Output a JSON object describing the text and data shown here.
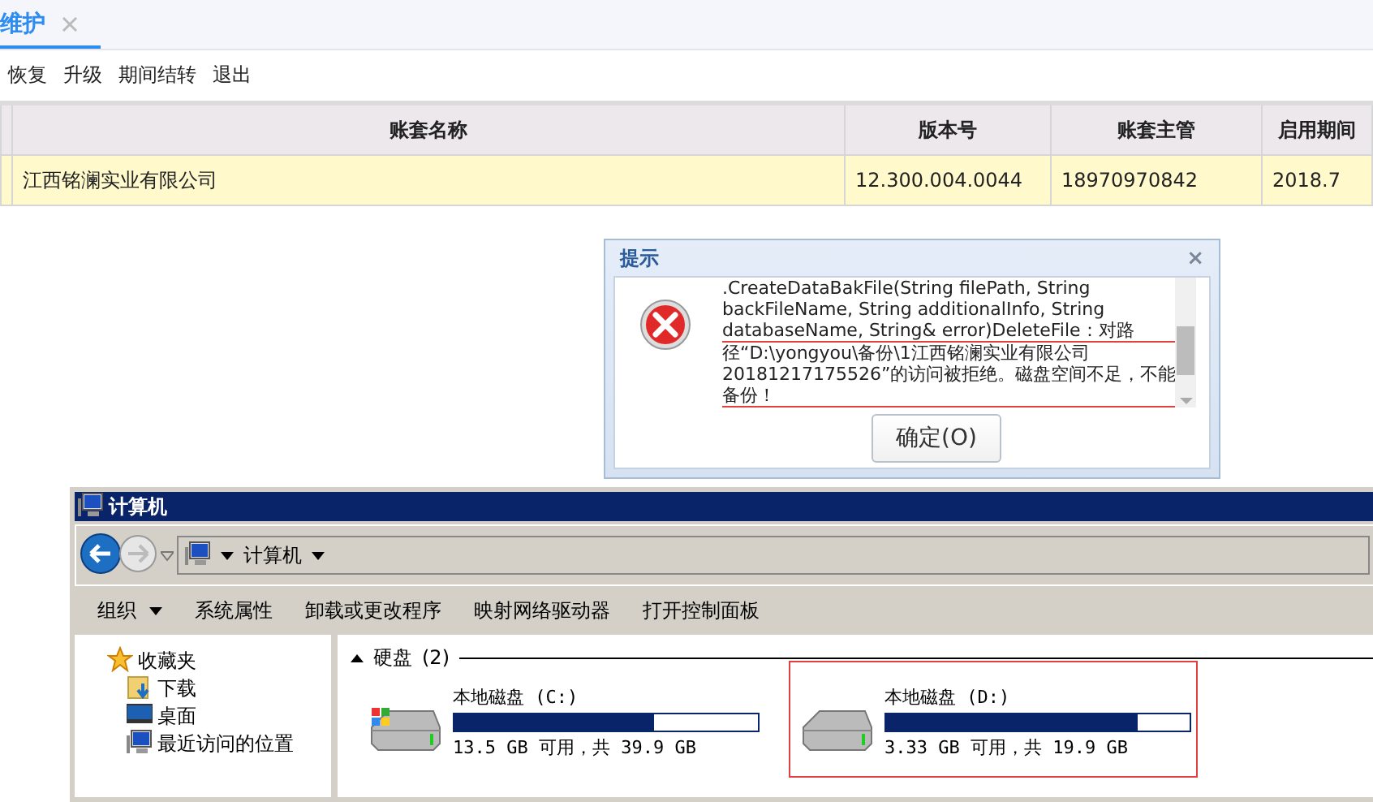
{
  "app": {
    "tabs": [
      {
        "label": "维护",
        "selected": true
      }
    ],
    "toolbar": [
      "恢复",
      "升级",
      "期间结转",
      "退出"
    ],
    "table": {
      "columns": [
        "账套名称",
        "版本号",
        "账套主管",
        "启用期间"
      ],
      "rows": [
        {
          "cells": [
            "江西铭澜实业有限公司",
            "12.300.004.0044",
            "18970970842",
            "2018.7"
          ],
          "selected": true
        }
      ]
    }
  },
  "dialog": {
    "title": "提示",
    "close": "×",
    "message": ".CreateDataBakFile(String filePath, String backFileName, String additionalInfo, String databaseName, String& error)DeleteFile：对路",
    "highlight": "径“D:\\yongyou\\备份\\1江西铭澜实业有限公司20181217175526”的访问被拒绝。磁盘空间不足，不能备份！",
    "button": "确定(O)"
  },
  "explorer": {
    "title": "计算机",
    "address": "计算机",
    "commands": [
      {
        "label": "组织",
        "dropdown": true
      },
      {
        "label": "系统属性",
        "dropdown": false
      },
      {
        "label": "卸载或更改程序",
        "dropdown": false
      },
      {
        "label": "映射网络驱动器",
        "dropdown": false
      },
      {
        "label": "打开控制面板",
        "dropdown": false
      }
    ],
    "favorites": {
      "label": "收藏夹",
      "children": [
        {
          "label": "下载",
          "kind": "download"
        },
        {
          "label": "桌面",
          "kind": "desktop"
        },
        {
          "label": "最近访问的位置",
          "kind": "recent"
        }
      ]
    },
    "group": {
      "label": "硬盘",
      "count": "(2)"
    },
    "drives": [
      {
        "name": "本地磁盘 (C:)",
        "kind": "system",
        "level": 0.66,
        "info": "13.5 GB 可用，共 39.9 GB",
        "highlighted": false
      },
      {
        "name": "本地磁盘 (D:)",
        "kind": "data",
        "level": 0.83,
        "info": "3.33 GB 可用，共 19.9 GB",
        "highlighted": true
      }
    ]
  }
}
